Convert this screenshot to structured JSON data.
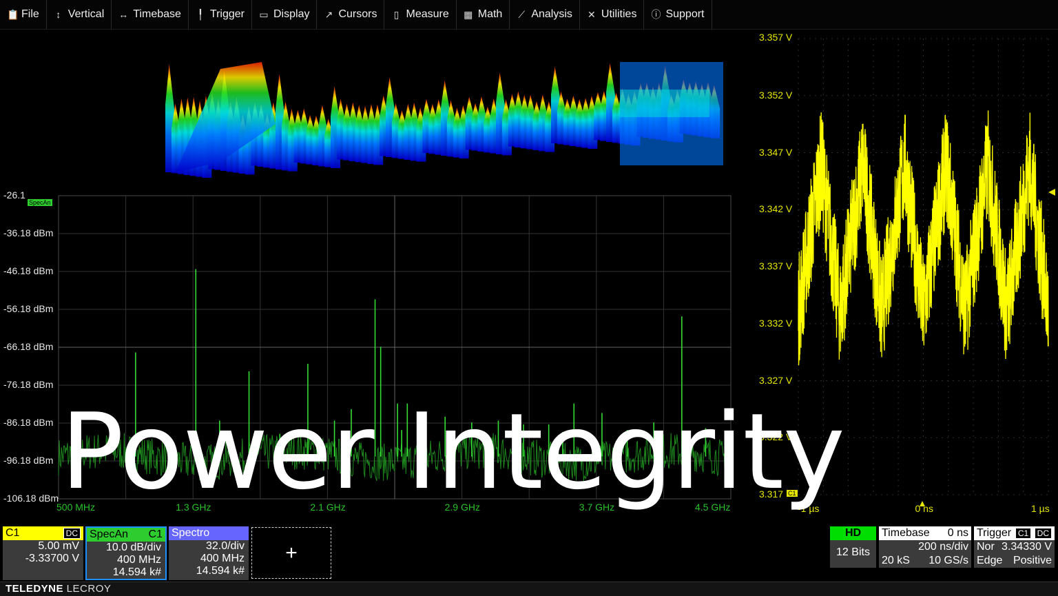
{
  "menu": [
    {
      "icon": "clipboard-icon",
      "glyph": "📋",
      "label": "File"
    },
    {
      "icon": "vertical-arrows-icon",
      "glyph": "↕",
      "label": "Vertical"
    },
    {
      "icon": "horizontal-arrows-icon",
      "glyph": "↔",
      "label": "Timebase"
    },
    {
      "icon": "trigger-icon",
      "glyph": "╿",
      "label": "Trigger"
    },
    {
      "icon": "display-icon",
      "glyph": "▭",
      "label": "Display"
    },
    {
      "icon": "cursor-icon",
      "glyph": "↗",
      "label": "Cursors"
    },
    {
      "icon": "measure-icon",
      "glyph": "▯",
      "label": "Measure"
    },
    {
      "icon": "calculator-icon",
      "glyph": "▦",
      "label": "Math"
    },
    {
      "icon": "chart-icon",
      "glyph": "⟋",
      "label": "Analysis"
    },
    {
      "icon": "tools-icon",
      "glyph": "✕",
      "label": "Utilities"
    },
    {
      "icon": "info-icon",
      "glyph": "ⓘ",
      "label": "Support"
    }
  ],
  "colors": {
    "channel1": "#ffff00",
    "specan": "#2ecc2e",
    "spectro": "#6666ff",
    "grid": "#3a3a3a"
  },
  "spectrum": {
    "y_labels": [
      "-26.1",
      "-36.18 dBm",
      "-46.18 dBm",
      "-56.18 dBm",
      "-66.18 dBm",
      "-76.18 dBm",
      "-86.18 dBm",
      "-96.18 dBm",
      "-106.18 dBm"
    ],
    "x_labels": [
      "500 MHz",
      "1.3 GHz",
      "2.1 GHz",
      "2.9 GHz",
      "3.7 GHz",
      "4.5 GHz"
    ],
    "trace_tag": "SpecAn"
  },
  "timetrace": {
    "y_labels": [
      "3.357 V",
      "3.352 V",
      "3.347 V",
      "3.342 V",
      "3.337 V",
      "3.332 V",
      "3.327 V",
      "3.322 V",
      "3.317"
    ],
    "x_labels": [
      "-1 µs",
      "0 ns",
      "1 µs"
    ],
    "trace_tag": "C1"
  },
  "chart_data": [
    {
      "type": "line",
      "title": "",
      "xlabel": "",
      "ylabel": "",
      "x_unit": "GHz",
      "y_unit": "dBm",
      "xlim": [
        0.1,
        4.9
      ],
      "ylim": [
        -106.18,
        -26.1
      ],
      "series": [
        {
          "peaks_x": [
            0.65,
            1.08,
            1.25,
            1.46,
            1.68,
            1.88,
            2.07,
            2.19,
            2.36,
            2.4,
            2.52,
            2.55,
            2.59,
            2.67,
            2.86,
            3.05,
            3.24,
            3.42,
            3.6,
            3.7,
            3.78,
            3.98,
            4.16,
            4.35,
            4.55,
            4.72
          ],
          "peaks_y": [
            -67.5,
            -45.5,
            -85.5,
            -72.5,
            -89,
            -70.5,
            -85.5,
            -82.5,
            -53.5,
            -66,
            -81,
            -88,
            -81,
            -88,
            -84.5,
            -86,
            -85.5,
            -86.5,
            -86.5,
            -88.5,
            -81,
            -83.5,
            -88,
            -86,
            -58,
            -87.5
          ]
        }
      ],
      "noise_floor_dbm": -95
    },
    {
      "type": "line",
      "title": "",
      "xlabel": "",
      "ylabel": "",
      "x_unit": "µs",
      "y_unit": "V",
      "xlim": [
        -1.0,
        1.0
      ],
      "ylim": [
        3.317,
        3.357
      ],
      "series": [
        {
          "waveform": "sawtooth",
          "offset_v": 3.3395,
          "amplitude_v": 0.0065,
          "cycles": 6,
          "noise_v": 0.005
        }
      ]
    }
  ],
  "descriptors": [
    {
      "key": "c1",
      "name": "C1",
      "tag": "DC",
      "color": "#ffff00",
      "rows": [
        "5.00 mV",
        "-3.33700 V"
      ]
    },
    {
      "key": "specan",
      "name": "SpecAn",
      "tag": "C1",
      "color": "#2ecc2e",
      "rows": [
        "10.0 dB/div",
        "400 MHz",
        "14.594 k#"
      ]
    },
    {
      "key": "spectro",
      "name": "Spectro",
      "tag": "",
      "color": "#6666ff",
      "rows": [
        "32.0/div",
        "400 MHz",
        "14.594 k#"
      ]
    }
  ],
  "add_label": "+",
  "acquisition": {
    "hd_label": "HD",
    "bits": "12 Bits",
    "timebase_label": "Timebase",
    "delay": "0 ns",
    "per_div": "200 ns/div",
    "samples": "20 kS",
    "rate": "10 GS/s",
    "trigger_label": "Trigger",
    "trigger_tag1": "C1",
    "trigger_tag2": "DC",
    "mode": "Nor",
    "level": "3.34330 V",
    "type": "Edge",
    "slope": "Positive"
  },
  "brand": {
    "bold": "TELEDYNE",
    "rest": " LECROY"
  },
  "overlay_title": "Power Integrity"
}
